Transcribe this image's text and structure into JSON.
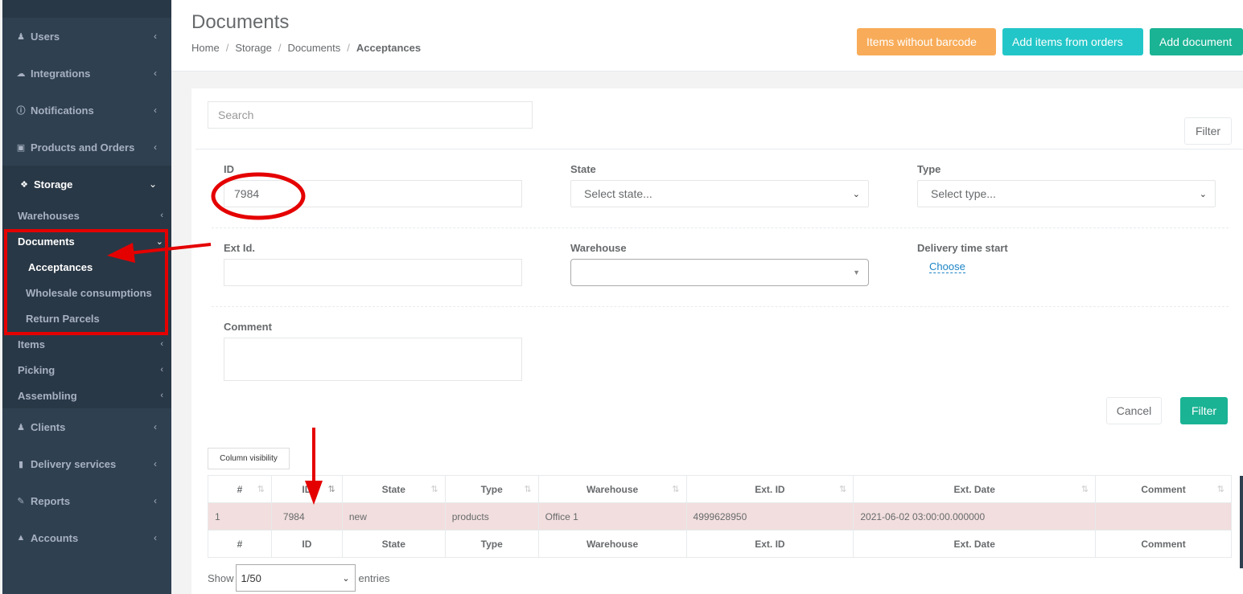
{
  "sidebar": {
    "items": [
      {
        "label": "Users",
        "icon": "user-icon"
      },
      {
        "label": "Integrations",
        "icon": "cloud-icon"
      },
      {
        "label": "Notifications",
        "icon": "info-icon"
      },
      {
        "label": "Products and Orders",
        "icon": "cart-icon"
      },
      {
        "label": "Storage",
        "icon": "cubes-icon"
      },
      {
        "label": "Clients",
        "icon": "users-icon"
      },
      {
        "label": "Delivery services",
        "icon": "truck-icon"
      },
      {
        "label": "Reports",
        "icon": "pencil-icon"
      },
      {
        "label": "Accounts",
        "icon": "graduation-icon"
      }
    ],
    "storage_sub": [
      "Warehouses",
      "Documents",
      "Items",
      "Picking",
      "Assembling"
    ],
    "documents_sub": [
      "Acceptances",
      "Wholesale consumptions",
      "Return Parcels"
    ]
  },
  "header": {
    "title": "Documents",
    "breadcrumb": [
      "Home",
      "Storage",
      "Documents",
      "Acceptances"
    ],
    "buttons": {
      "items_without_barcode": "Items without barcode",
      "add_items_from_orders": "Add items from orders",
      "add_document": "Add document"
    },
    "colors": {
      "warning": "#f8ac59",
      "info": "#23c6c8",
      "primary": "#1ab394"
    }
  },
  "filters": {
    "search_placeholder": "Search",
    "filter_toggle": "Filter",
    "id_label": "ID",
    "id_value": "7984",
    "state_label": "State",
    "state_placeholder": "Select state...",
    "type_label": "Type",
    "type_placeholder": "Select type...",
    "ext_id_label": "Ext Id.",
    "warehouse_label": "Warehouse",
    "delivery_label": "Delivery time start",
    "delivery_choose": "Choose",
    "comment_label": "Comment",
    "cancel": "Cancel",
    "submit": "Filter"
  },
  "table": {
    "column_visibility": "Column visibility",
    "headers": [
      "#",
      "ID",
      "State",
      "Type",
      "Warehouse",
      "Ext. ID",
      "Ext. Date",
      "Comment"
    ],
    "rows": [
      [
        "1",
        "7984",
        "new",
        "products",
        "Office 1",
        "4999628950",
        "2021-06-02 03:00:00.000000",
        ""
      ]
    ],
    "show_label": "Show",
    "show_value": "1/50",
    "entries_label": "entries"
  }
}
